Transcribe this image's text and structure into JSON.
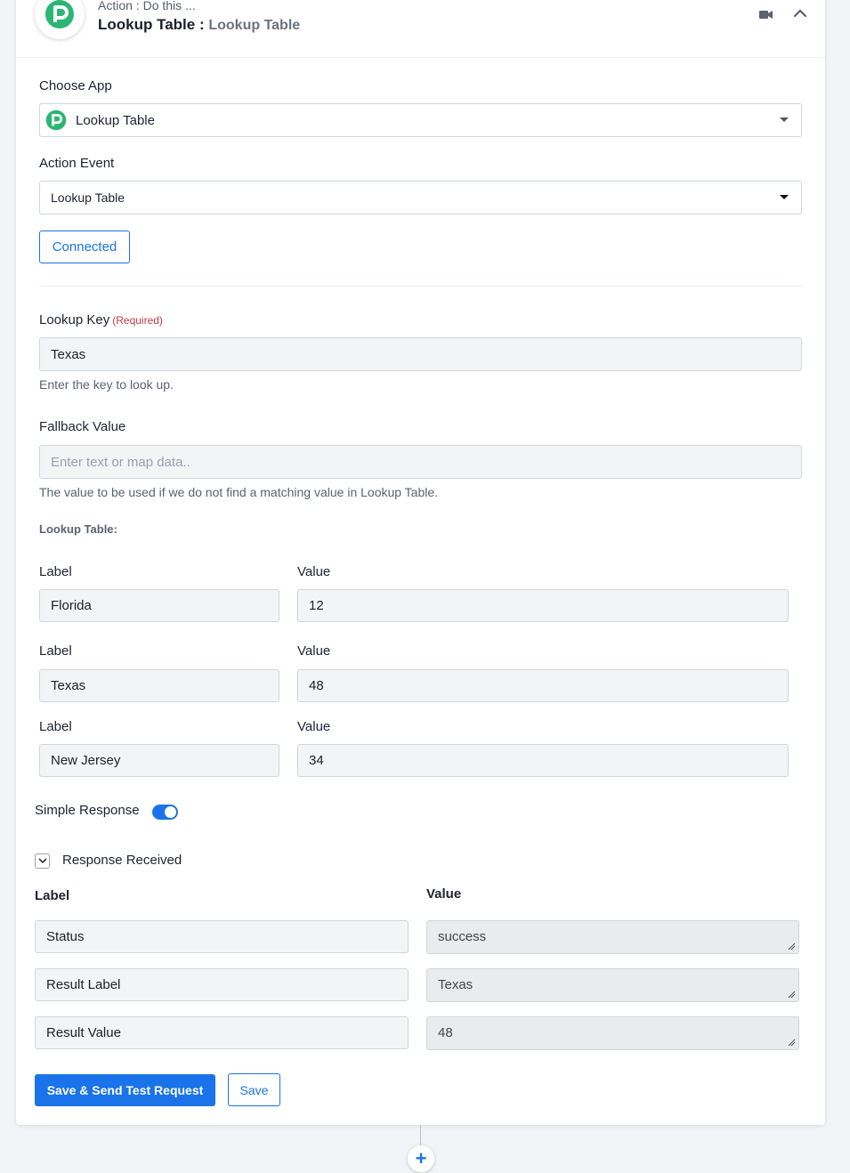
{
  "header": {
    "subtitle": "Action : Do this ...",
    "title_main": "Lookup Table",
    "title_separator": " : ",
    "title_light": "Lookup Table"
  },
  "choose_app": {
    "label": "Choose App",
    "value": "Lookup Table"
  },
  "action_event": {
    "label": "Action Event",
    "value": "Lookup Table"
  },
  "connected_label": "Connected",
  "lookup_key": {
    "label": "Lookup Key",
    "required": "(Required)",
    "value": "Texas",
    "help": "Enter the key to look up."
  },
  "fallback": {
    "label": "Fallback Value",
    "placeholder": "Enter text or map data..",
    "help": "The value to be used if we do not find a matching value in Lookup Table."
  },
  "lookup_table": {
    "heading": "Lookup Table:",
    "label_header": "Label",
    "value_header": "Value",
    "rows": [
      {
        "label": "Florida",
        "value": "12"
      },
      {
        "label": "Texas",
        "value": "48"
      },
      {
        "label": "New Jersey",
        "value": "34"
      }
    ]
  },
  "simple_response": {
    "label": "Simple Response",
    "on": true
  },
  "response": {
    "title": "Response Received",
    "label_header": "Label",
    "value_header": "Value",
    "rows": [
      {
        "label": "Status",
        "value": "success"
      },
      {
        "label": "Result Label",
        "value": "Texas"
      },
      {
        "label": "Result Value",
        "value": "48"
      }
    ]
  },
  "buttons": {
    "save_send": "Save & Send Test Request",
    "save": "Save"
  },
  "colors": {
    "accent": "#1a73e8",
    "logo": "#2bb673",
    "required": "#c0394b"
  },
  "icons": {
    "video": "video-camera-icon",
    "collapse": "chevron-up-icon",
    "add": "plus-icon"
  }
}
